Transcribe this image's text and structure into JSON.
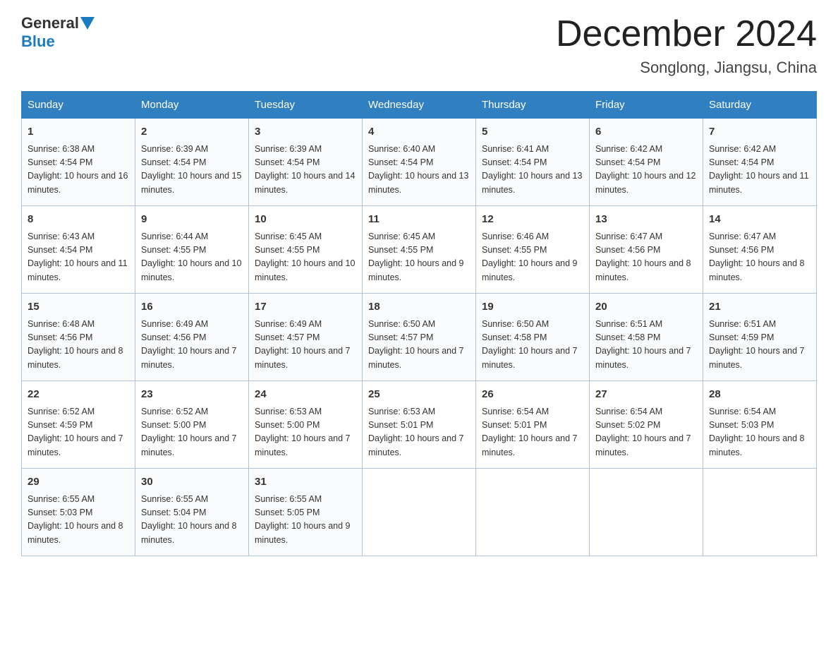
{
  "header": {
    "logo_general": "General",
    "logo_blue": "Blue",
    "month_title": "December 2024",
    "location": "Songlong, Jiangsu, China"
  },
  "days_of_week": [
    "Sunday",
    "Monday",
    "Tuesday",
    "Wednesday",
    "Thursday",
    "Friday",
    "Saturday"
  ],
  "weeks": [
    [
      {
        "day": "1",
        "sunrise": "6:38 AM",
        "sunset": "4:54 PM",
        "daylight": "10 hours and 16 minutes."
      },
      {
        "day": "2",
        "sunrise": "6:39 AM",
        "sunset": "4:54 PM",
        "daylight": "10 hours and 15 minutes."
      },
      {
        "day": "3",
        "sunrise": "6:39 AM",
        "sunset": "4:54 PM",
        "daylight": "10 hours and 14 minutes."
      },
      {
        "day": "4",
        "sunrise": "6:40 AM",
        "sunset": "4:54 PM",
        "daylight": "10 hours and 13 minutes."
      },
      {
        "day": "5",
        "sunrise": "6:41 AM",
        "sunset": "4:54 PM",
        "daylight": "10 hours and 13 minutes."
      },
      {
        "day": "6",
        "sunrise": "6:42 AM",
        "sunset": "4:54 PM",
        "daylight": "10 hours and 12 minutes."
      },
      {
        "day": "7",
        "sunrise": "6:42 AM",
        "sunset": "4:54 PM",
        "daylight": "10 hours and 11 minutes."
      }
    ],
    [
      {
        "day": "8",
        "sunrise": "6:43 AM",
        "sunset": "4:54 PM",
        "daylight": "10 hours and 11 minutes."
      },
      {
        "day": "9",
        "sunrise": "6:44 AM",
        "sunset": "4:55 PM",
        "daylight": "10 hours and 10 minutes."
      },
      {
        "day": "10",
        "sunrise": "6:45 AM",
        "sunset": "4:55 PM",
        "daylight": "10 hours and 10 minutes."
      },
      {
        "day": "11",
        "sunrise": "6:45 AM",
        "sunset": "4:55 PM",
        "daylight": "10 hours and 9 minutes."
      },
      {
        "day": "12",
        "sunrise": "6:46 AM",
        "sunset": "4:55 PM",
        "daylight": "10 hours and 9 minutes."
      },
      {
        "day": "13",
        "sunrise": "6:47 AM",
        "sunset": "4:56 PM",
        "daylight": "10 hours and 8 minutes."
      },
      {
        "day": "14",
        "sunrise": "6:47 AM",
        "sunset": "4:56 PM",
        "daylight": "10 hours and 8 minutes."
      }
    ],
    [
      {
        "day": "15",
        "sunrise": "6:48 AM",
        "sunset": "4:56 PM",
        "daylight": "10 hours and 8 minutes."
      },
      {
        "day": "16",
        "sunrise": "6:49 AM",
        "sunset": "4:56 PM",
        "daylight": "10 hours and 7 minutes."
      },
      {
        "day": "17",
        "sunrise": "6:49 AM",
        "sunset": "4:57 PM",
        "daylight": "10 hours and 7 minutes."
      },
      {
        "day": "18",
        "sunrise": "6:50 AM",
        "sunset": "4:57 PM",
        "daylight": "10 hours and 7 minutes."
      },
      {
        "day": "19",
        "sunrise": "6:50 AM",
        "sunset": "4:58 PM",
        "daylight": "10 hours and 7 minutes."
      },
      {
        "day": "20",
        "sunrise": "6:51 AM",
        "sunset": "4:58 PM",
        "daylight": "10 hours and 7 minutes."
      },
      {
        "day": "21",
        "sunrise": "6:51 AM",
        "sunset": "4:59 PM",
        "daylight": "10 hours and 7 minutes."
      }
    ],
    [
      {
        "day": "22",
        "sunrise": "6:52 AM",
        "sunset": "4:59 PM",
        "daylight": "10 hours and 7 minutes."
      },
      {
        "day": "23",
        "sunrise": "6:52 AM",
        "sunset": "5:00 PM",
        "daylight": "10 hours and 7 minutes."
      },
      {
        "day": "24",
        "sunrise": "6:53 AM",
        "sunset": "5:00 PM",
        "daylight": "10 hours and 7 minutes."
      },
      {
        "day": "25",
        "sunrise": "6:53 AM",
        "sunset": "5:01 PM",
        "daylight": "10 hours and 7 minutes."
      },
      {
        "day": "26",
        "sunrise": "6:54 AM",
        "sunset": "5:01 PM",
        "daylight": "10 hours and 7 minutes."
      },
      {
        "day": "27",
        "sunrise": "6:54 AM",
        "sunset": "5:02 PM",
        "daylight": "10 hours and 7 minutes."
      },
      {
        "day": "28",
        "sunrise": "6:54 AM",
        "sunset": "5:03 PM",
        "daylight": "10 hours and 8 minutes."
      }
    ],
    [
      {
        "day": "29",
        "sunrise": "6:55 AM",
        "sunset": "5:03 PM",
        "daylight": "10 hours and 8 minutes."
      },
      {
        "day": "30",
        "sunrise": "6:55 AM",
        "sunset": "5:04 PM",
        "daylight": "10 hours and 8 minutes."
      },
      {
        "day": "31",
        "sunrise": "6:55 AM",
        "sunset": "5:05 PM",
        "daylight": "10 hours and 9 minutes."
      },
      null,
      null,
      null,
      null
    ]
  ]
}
